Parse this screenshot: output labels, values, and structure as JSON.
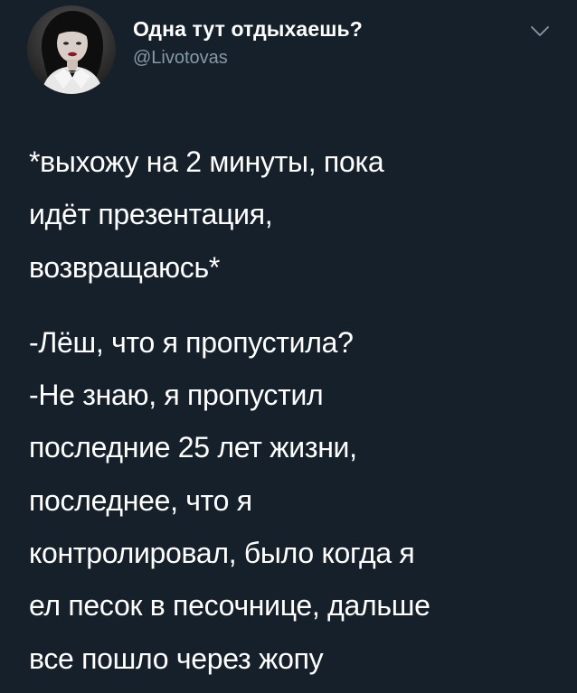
{
  "tweet": {
    "author": {
      "display_name": "Одна тут отдыхаешь?",
      "handle": "@Livotovas"
    },
    "menu_icon": "chevron-down-icon",
    "text": {
      "paragraph_1": [
        "*выхожу на 2 минуты, пока",
        "идёт презентация,",
        "возвращаюсь*"
      ],
      "paragraph_2": [
        "-Лёш, что я пропустила?",
        "-Не знаю, я пропустил",
        "последние 25 лет жизни,",
        "последнее, что я",
        "контролировал, было когда я",
        "ел песок в песочнице, дальше",
        "все пошло через жопу"
      ]
    },
    "colors": {
      "background": "#15202b",
      "secondary_text": "#8899a6",
      "primary_text": "#ffffff"
    }
  }
}
